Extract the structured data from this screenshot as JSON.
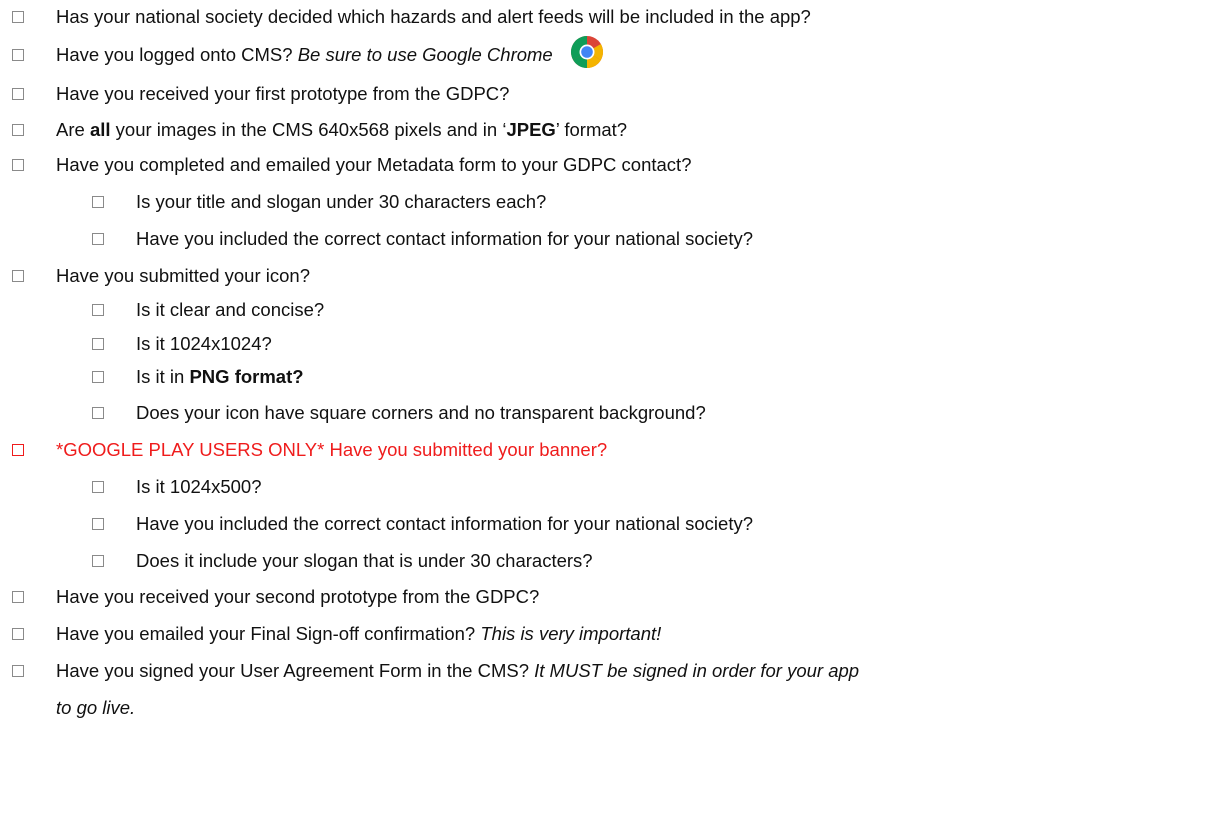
{
  "items": {
    "hazards": "Has your national society decided which hazards and alert feeds will be included in the app?",
    "cms_logon": "Have you logged onto CMS?",
    "cms_logon_note": "Be sure to use Google Chrome",
    "chrome_icon": "chrome-logo-icon",
    "first_prototype": "Have you received your first prototype from the GDPC?",
    "images_prefix": "Are ",
    "images_all": "all",
    "images_mid": " your images in the CMS 640x568 pixels and in ‘",
    "images_jpeg": "JPEG",
    "images_suffix": "’ format?",
    "metadata": "Have you completed and emailed your Metadata form to your GDPC contact?",
    "metadata_title": "Is your title and slogan under 30 characters each?",
    "metadata_contact": "Have you included the correct contact information for your national society?",
    "icon": "Have you submitted your icon?",
    "icon_clear": "Is it clear and concise?",
    "icon_size": "Is it 1024x1024?",
    "icon_png_prefix": "Is it in ",
    "icon_png": "PNG format?",
    "icon_corners": "Does your icon have square corners and no transparent background?",
    "banner": "*GOOGLE PLAY USERS ONLY* Have you submitted your banner?",
    "banner_size": "Is it 1024x500?",
    "banner_contact": "Have you included the correct contact information for your national society?",
    "banner_slogan": "Does it include your slogan that is under 30 characters?",
    "second_prototype": "Have you received your second prototype from the GDPC?",
    "signoff": "Have you emailed your Final Sign-off confirmation?",
    "signoff_note": "This is very important!",
    "agreement": "Have you signed your User Agreement Form in the CMS?",
    "agreement_note_line1": "It MUST be signed in order for your app",
    "agreement_note_line2": "to go live."
  },
  "colors": {
    "text": "#111111",
    "warning": "#ef1c1c",
    "checkbox_border": "#8a8a8a"
  }
}
